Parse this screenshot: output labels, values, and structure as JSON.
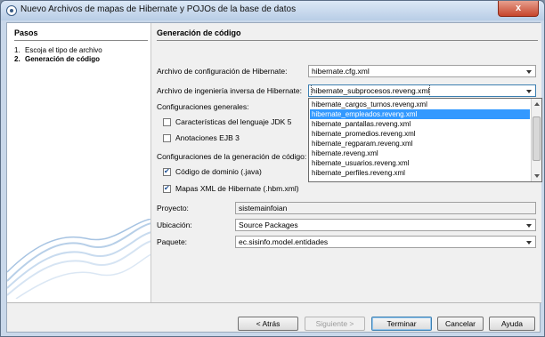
{
  "window": {
    "title": "Nuevo Archivos de mapas de Hibernate y POJOs de la base de datos",
    "close_label": "x"
  },
  "steps": {
    "title": "Pasos",
    "items": [
      {
        "num": "1.",
        "label": "Escoja el tipo de archivo"
      },
      {
        "num": "2.",
        "label": "Generación de código"
      }
    ]
  },
  "main": {
    "heading": "Generación de código",
    "config_label": "Archivo de configuración de Hibernate:",
    "config_value": "hibernate.cfg.xml",
    "reveng_label": "Archivo de ingeniería inversa de Hibernate:",
    "reveng_value": "hibernate_subprocesos.reveng.xml",
    "general_label": "Configuraciones generales:",
    "jdk5_label": "Características del lenguaje JDK 5",
    "ejb3_label": "Anotaciones EJB 3",
    "codegen_label": "Configuraciones de la generación de código:",
    "domain_code_label": "Código de dominio (.java)",
    "xml_mappings_label": "Mapas XML de Hibernate (.hbm.xml)",
    "project_label": "Proyecto:",
    "project_value": "sistemainfoian",
    "location_label": "Ubicación:",
    "location_value": "Source Packages",
    "package_label": "Paquete:",
    "package_value": "ec.sisinfo.model.entidades"
  },
  "dropdown": {
    "items": [
      "hibernate_cargos_turnos.reveng.xml",
      "hibernate_empleados.reveng.xml",
      "hibernate_pantallas.reveng.xml",
      "hibernate_promedios.reveng.xml",
      "hibernate_regparam.reveng.xml",
      "hibernate.reveng.xml",
      "hibernate_usuarios.reveng.xml",
      "hibernate_perfiles.reveng.xml"
    ],
    "selected_index": 1
  },
  "buttons": {
    "back": "< Atrás",
    "next": "Siguiente >",
    "finish": "Terminar",
    "cancel": "Cancelar",
    "help": "Ayuda"
  }
}
